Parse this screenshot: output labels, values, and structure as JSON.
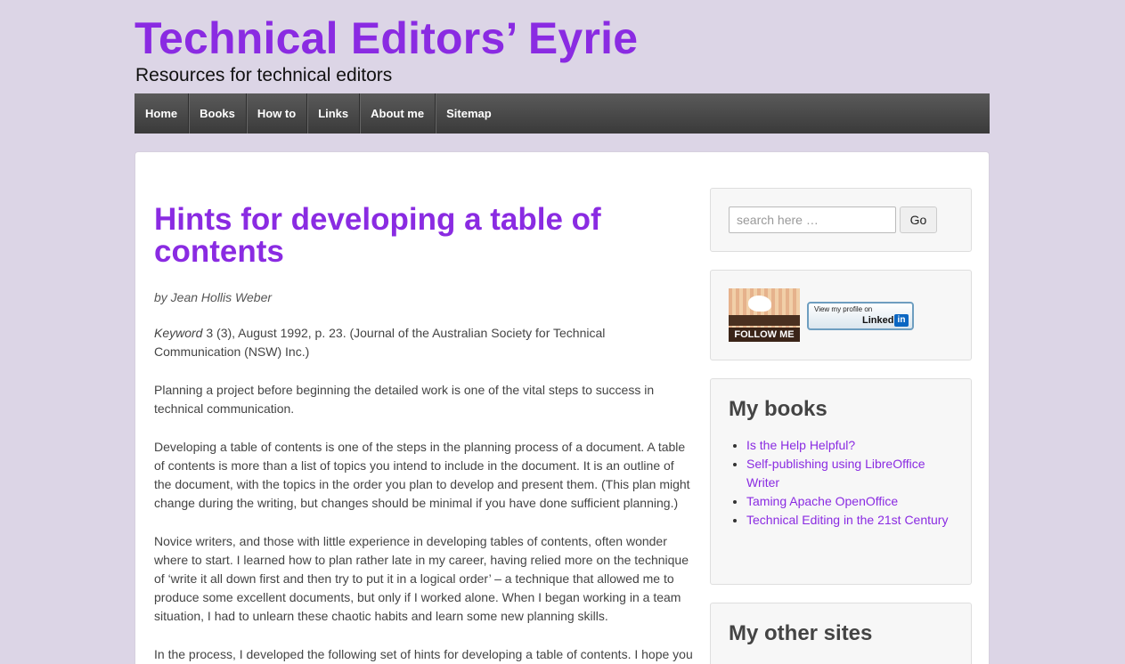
{
  "header": {
    "site_title": "Technical Editors’ Eyrie",
    "tagline": "Resources for technical editors"
  },
  "nav": {
    "items": [
      "Home",
      "Books",
      "How to",
      "Links",
      "About me",
      "Sitemap"
    ]
  },
  "article": {
    "title": "Hints for developing a table of contents",
    "byline": "by Jean Hollis Weber",
    "citation_journal": "Keyword",
    "citation_rest": " 3 (3), August 1992, p. 23. (Journal of the Australian Society for Technical Communication (NSW) Inc.)",
    "paragraphs": [
      "Planning a project before beginning the detailed work is one of the vital steps to success in technical communication.",
      "Developing a table of contents is one of the steps in the planning process of a document. A table of contents is more than a list of topics you intend to include in the document. It is an outline of the document, with the topics in the order you plan to develop and present them. (This plan might change during the writing, but changes should be minimal if you have done sufficient planning.)",
      "Novice writers, and those with little experience in developing tables of contents, often wonder where to start. I learned how to plan rather late in my career, having relied more on the technique of ‘write it all down first and then try to put it in a logical order’ – a technique that allowed me to produce some excellent documents, but only if I worked alone. When I began working in a team situation, I had to unlearn these chaotic habits and learn some new planning skills.",
      "In the process, I developed the following set of hints for developing a table of contents. I hope you"
    ]
  },
  "sidebar": {
    "search": {
      "placeholder": "search here …",
      "button_label": "Go"
    },
    "social": {
      "follow_label": "FOLLOW ME",
      "linkedin_small": "View my profile on",
      "linkedin_brand": "Linked",
      "linkedin_in": "in"
    },
    "books": {
      "title": "My books",
      "items": [
        "Is the Help Helpful?",
        "Self-publishing using LibreOffice Writer",
        "Taming Apache OpenOffice",
        "Technical Editing in the 21st Century"
      ]
    },
    "other_sites": {
      "title": "My other sites"
    }
  }
}
